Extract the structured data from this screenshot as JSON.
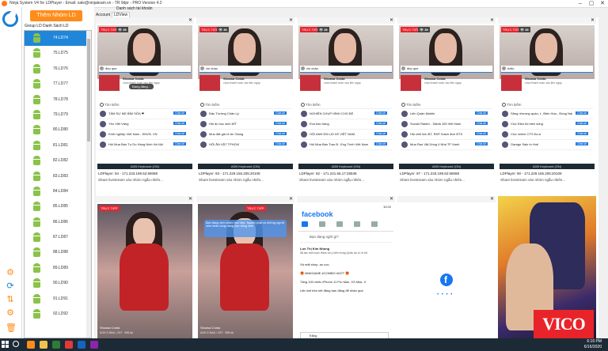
{
  "window": {
    "title": "Ninja System V4 for LDPlayer - Email: sale@ninjateam.vn - TR 9dpr - PRO Version 4.2"
  },
  "sidebar": {
    "add_group_label": "Thêm Nhóm LD",
    "tabs": [
      "Group LD",
      "Danh Sách LD"
    ],
    "items": [
      "74.LD74",
      "75.LD75",
      "76.LD76",
      "77.LD77",
      "78.LD78",
      "79.LD79",
      "80.LD80",
      "81.LD81",
      "82.LD82",
      "83.LD83",
      "84.LD84",
      "85.LD85",
      "86.LD86",
      "87.LD87",
      "88.LD88",
      "89.LD89",
      "90.LD90",
      "91.LD91",
      "92.LD92"
    ],
    "selected_index": 0
  },
  "top_tabs": {
    "group": "Danh sách tài khoản",
    "account": "Account",
    "ldview": "LDView"
  },
  "tiles_top": [
    {
      "comment": "đep que",
      "caption": "LDPlayer: 94 - 171.233.199.52:58088",
      "caption2": "Share livestream vào nhóm ngẫu nhiên...",
      "rows": [
        "TÂM SỰ MẸ BỈM SỮA ❤",
        "Yêu Việt Vàng",
        "Khởi nghiệp Việt Nam - KNVN. VN",
        "Hội Mua Bán Tự Do Hàng Ninh Hà Nội"
      ],
      "toast": "Đang đăng..."
    },
    {
      "comment": "xin chào",
      "caption": "LDPlayer: 93 - 171.229.155.205:20109",
      "caption2": "Share livestream vào nhóm ngẫu nhiên...",
      "rows": [
        "Đấu Trường Chân Lý",
        "Hội ăn hoc sinh MỸ",
        "Mua đất giá rẻ An Giang",
        "HỘI ĂN VẶT TPHCM"
      ]
    },
    {
      "comment": "xin chào",
      "caption": "LDPlayer: 92 - 171.241.65.17:28538",
      "caption2": "Share livestream vào nhóm ngẫu nhiên...",
      "rows": [
        "NGHIỆN CHỤP HÌNH CHO BÉ",
        "Eva bán hàng",
        "HỘI ANH EM LÁI XE VIỆT NAM",
        "Hội Mua Bán Trao Đ. Ứng Trình Việt Nam"
      ]
    },
    {
      "comment": "đep que",
      "caption": "LDPlayer: 97 - 171.233.199.52:58088",
      "caption2": "Share livestream vào nhóm ngẫu nhiên...",
      "rows": [
        "Liên Quân Mobile",
        "Suzuki Raider - Satria 150 Việt Nam",
        "Hội chill lính BT, RMT thách đơn BTS",
        "Mua Rao Vặt Dòng 4 Nhà TP Xanh"
      ]
    },
    {
      "comment": "hello",
      "caption": "LDPlayer: 90 - 171.229.155.205:20109",
      "caption2": "Share livestream vào nhóm ngẫu nhiên...",
      "rows": [
        "Săng nhượng quán, t...Biên Hòa - Đồng Nai",
        "Chợ Điều thị biên sống",
        "Chợ online CTS.Ka.a",
        "Garage Sale in Huế"
      ]
    }
  ],
  "live_label": "TRỰC TIẾP",
  "viewer_count": "39",
  "product": {
    "title": "Shoasa Costa",
    "subtitle": "chọn thanh toán vào liên ngay"
  },
  "search_label": "Tìm kiếm",
  "share_button": "Chia sẻ",
  "keyboard": "ADB Keyboard (ON)",
  "bottom": {
    "streamer": "Shoasa Costa",
    "streamer_sub": "AOH 2 MAU • 297 · 996 lại",
    "bubble": "Bạn đang xem video trực tiếp. Người phát có những người xem khác cùng đang bạn đang xem",
    "facebook": {
      "logo": "facebook",
      "composer": "Bạn đang nghĩ gì?",
      "post_author": "Lực Thị Kim Nhung",
      "post_meta": "đã tạo một cuộc thăm dò ý kiến trong Quân áo si, lẻ tốt",
      "post_lines": [
        "Xả mặt shop, ao cọc.",
        "🎁 MINIGAME #COMBO #0ỚT 🎁",
        "Tăng 100 chiếc iPhone 11 Pro Max, XS Max, X.",
        "Liên kết trên kết đăng bạn đăng để nhận quà"
      ],
      "option": "Trắng",
      "time": "10:22"
    }
  },
  "brand": "VICO",
  "taskbar": {
    "time": "6:16 PM",
    "date": "6/16/2020"
  }
}
